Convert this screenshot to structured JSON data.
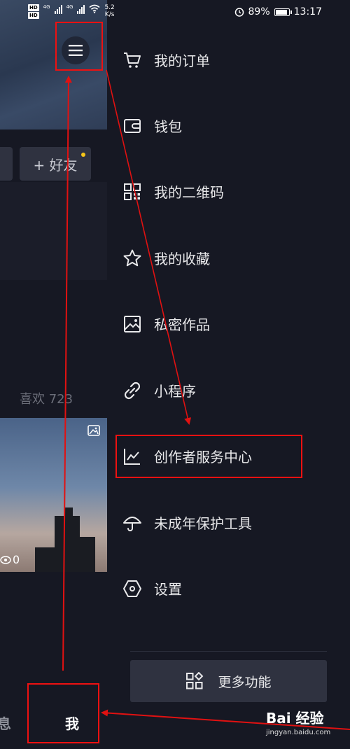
{
  "status_bar": {
    "hd_badges": [
      "HD",
      "HD"
    ],
    "network_a": "4G",
    "network_b": "4G",
    "speed_value": "5.2",
    "speed_unit": "K/s",
    "battery": "89%",
    "battery_level": 0.89,
    "time": "13:17"
  },
  "profile_page": {
    "add_friend_label": "+ 好友",
    "likes_label": "喜欢 723",
    "video_views": "0",
    "nav": {
      "messages_partial": "息",
      "me": "我"
    }
  },
  "drawer": {
    "items": [
      {
        "label": "我的订单",
        "icon": "cart-icon"
      },
      {
        "label": "钱包",
        "icon": "wallet-icon"
      },
      {
        "label": "我的二维码",
        "icon": "qr-code-icon"
      },
      {
        "label": "我的收藏",
        "icon": "star-icon"
      },
      {
        "label": "私密作品",
        "icon": "image-icon"
      },
      {
        "label": "小程序",
        "icon": "link-icon"
      },
      {
        "label": "创作者服务中心",
        "icon": "chart-icon"
      },
      {
        "label": "未成年保护工具",
        "icon": "umbrella-icon"
      },
      {
        "label": "设置",
        "icon": "hexagon-settings-icon"
      }
    ],
    "more_label": "更多功能"
  },
  "annotation_color": "#e11111",
  "watermark": {
    "logo": "Bai 经验",
    "url": "jingyan.baidu.com"
  }
}
